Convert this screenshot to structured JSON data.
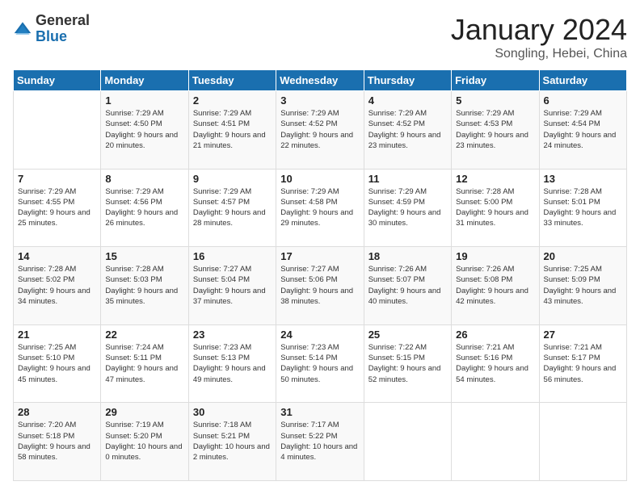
{
  "logo": {
    "general": "General",
    "blue": "Blue"
  },
  "title": "January 2024",
  "location": "Songling, Hebei, China",
  "days_of_week": [
    "Sunday",
    "Monday",
    "Tuesday",
    "Wednesday",
    "Thursday",
    "Friday",
    "Saturday"
  ],
  "weeks": [
    [
      {
        "day": "",
        "info": ""
      },
      {
        "day": "1",
        "info": "Sunrise: 7:29 AM\nSunset: 4:50 PM\nDaylight: 9 hours\nand 20 minutes."
      },
      {
        "day": "2",
        "info": "Sunrise: 7:29 AM\nSunset: 4:51 PM\nDaylight: 9 hours\nand 21 minutes."
      },
      {
        "day": "3",
        "info": "Sunrise: 7:29 AM\nSunset: 4:52 PM\nDaylight: 9 hours\nand 22 minutes."
      },
      {
        "day": "4",
        "info": "Sunrise: 7:29 AM\nSunset: 4:52 PM\nDaylight: 9 hours\nand 23 minutes."
      },
      {
        "day": "5",
        "info": "Sunrise: 7:29 AM\nSunset: 4:53 PM\nDaylight: 9 hours\nand 23 minutes."
      },
      {
        "day": "6",
        "info": "Sunrise: 7:29 AM\nSunset: 4:54 PM\nDaylight: 9 hours\nand 24 minutes."
      }
    ],
    [
      {
        "day": "7",
        "info": "Sunrise: 7:29 AM\nSunset: 4:55 PM\nDaylight: 9 hours\nand 25 minutes."
      },
      {
        "day": "8",
        "info": "Sunrise: 7:29 AM\nSunset: 4:56 PM\nDaylight: 9 hours\nand 26 minutes."
      },
      {
        "day": "9",
        "info": "Sunrise: 7:29 AM\nSunset: 4:57 PM\nDaylight: 9 hours\nand 28 minutes."
      },
      {
        "day": "10",
        "info": "Sunrise: 7:29 AM\nSunset: 4:58 PM\nDaylight: 9 hours\nand 29 minutes."
      },
      {
        "day": "11",
        "info": "Sunrise: 7:29 AM\nSunset: 4:59 PM\nDaylight: 9 hours\nand 30 minutes."
      },
      {
        "day": "12",
        "info": "Sunrise: 7:28 AM\nSunset: 5:00 PM\nDaylight: 9 hours\nand 31 minutes."
      },
      {
        "day": "13",
        "info": "Sunrise: 7:28 AM\nSunset: 5:01 PM\nDaylight: 9 hours\nand 33 minutes."
      }
    ],
    [
      {
        "day": "14",
        "info": "Sunrise: 7:28 AM\nSunset: 5:02 PM\nDaylight: 9 hours\nand 34 minutes."
      },
      {
        "day": "15",
        "info": "Sunrise: 7:28 AM\nSunset: 5:03 PM\nDaylight: 9 hours\nand 35 minutes."
      },
      {
        "day": "16",
        "info": "Sunrise: 7:27 AM\nSunset: 5:04 PM\nDaylight: 9 hours\nand 37 minutes."
      },
      {
        "day": "17",
        "info": "Sunrise: 7:27 AM\nSunset: 5:06 PM\nDaylight: 9 hours\nand 38 minutes."
      },
      {
        "day": "18",
        "info": "Sunrise: 7:26 AM\nSunset: 5:07 PM\nDaylight: 9 hours\nand 40 minutes."
      },
      {
        "day": "19",
        "info": "Sunrise: 7:26 AM\nSunset: 5:08 PM\nDaylight: 9 hours\nand 42 minutes."
      },
      {
        "day": "20",
        "info": "Sunrise: 7:25 AM\nSunset: 5:09 PM\nDaylight: 9 hours\nand 43 minutes."
      }
    ],
    [
      {
        "day": "21",
        "info": "Sunrise: 7:25 AM\nSunset: 5:10 PM\nDaylight: 9 hours\nand 45 minutes."
      },
      {
        "day": "22",
        "info": "Sunrise: 7:24 AM\nSunset: 5:11 PM\nDaylight: 9 hours\nand 47 minutes."
      },
      {
        "day": "23",
        "info": "Sunrise: 7:23 AM\nSunset: 5:13 PM\nDaylight: 9 hours\nand 49 minutes."
      },
      {
        "day": "24",
        "info": "Sunrise: 7:23 AM\nSunset: 5:14 PM\nDaylight: 9 hours\nand 50 minutes."
      },
      {
        "day": "25",
        "info": "Sunrise: 7:22 AM\nSunset: 5:15 PM\nDaylight: 9 hours\nand 52 minutes."
      },
      {
        "day": "26",
        "info": "Sunrise: 7:21 AM\nSunset: 5:16 PM\nDaylight: 9 hours\nand 54 minutes."
      },
      {
        "day": "27",
        "info": "Sunrise: 7:21 AM\nSunset: 5:17 PM\nDaylight: 9 hours\nand 56 minutes."
      }
    ],
    [
      {
        "day": "28",
        "info": "Sunrise: 7:20 AM\nSunset: 5:18 PM\nDaylight: 9 hours\nand 58 minutes."
      },
      {
        "day": "29",
        "info": "Sunrise: 7:19 AM\nSunset: 5:20 PM\nDaylight: 10 hours\nand 0 minutes."
      },
      {
        "day": "30",
        "info": "Sunrise: 7:18 AM\nSunset: 5:21 PM\nDaylight: 10 hours\nand 2 minutes."
      },
      {
        "day": "31",
        "info": "Sunrise: 7:17 AM\nSunset: 5:22 PM\nDaylight: 10 hours\nand 4 minutes."
      },
      {
        "day": "",
        "info": ""
      },
      {
        "day": "",
        "info": ""
      },
      {
        "day": "",
        "info": ""
      }
    ]
  ]
}
